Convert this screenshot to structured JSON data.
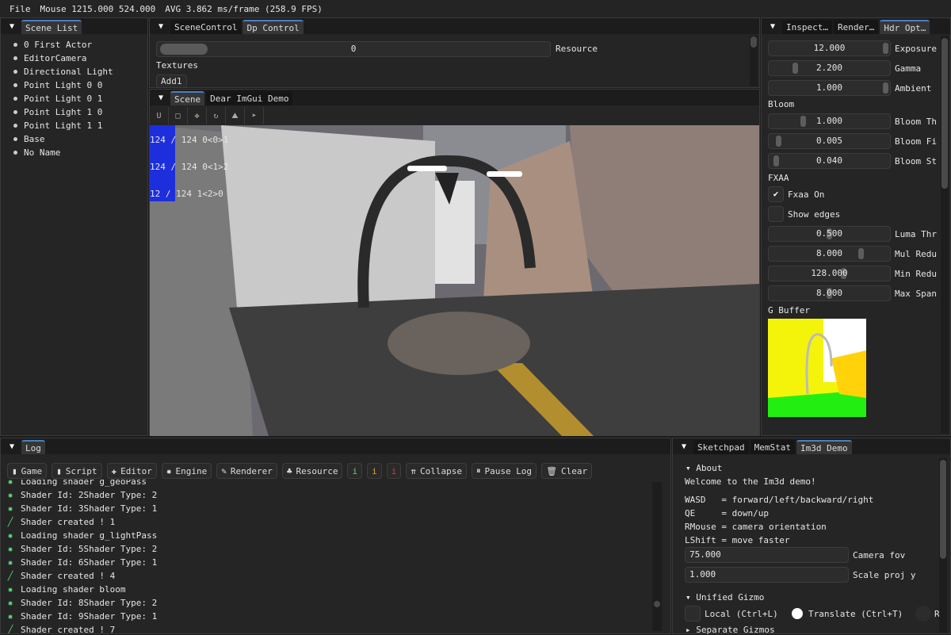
{
  "menu": {
    "file": "File",
    "mouse": "Mouse 1215.000 524.000",
    "avg": "AVG 3.862 ms/frame (258.9 FPS)"
  },
  "scene_list": {
    "tab": "Scene List",
    "items": [
      "0 First Actor",
      "EditorCamera",
      "Directional Light",
      "Point Light 0 0",
      "Point Light 0 1",
      "Point Light 1 0",
      "Point Light 1 1",
      "Base",
      "No Name"
    ]
  },
  "top_center": {
    "tabs": [
      "SceneControl",
      "Dp Control"
    ],
    "resource_value": "0",
    "resource_label": "Resource",
    "textures": "Textures",
    "add_button": "Add1"
  },
  "scene": {
    "tabs": [
      "Scene",
      "Dear ImGui Demo"
    ],
    "toolbar": [
      "magnet-icon",
      "select-icon",
      "move-icon",
      "rotate-icon",
      "scale-icon",
      "cursor-icon"
    ],
    "overlay": [
      "124 / 124 0<0>1",
      "124 / 124 0<1>2",
      "12 / 124 1<2>0"
    ]
  },
  "right": {
    "tabs": [
      "Inspect…",
      "Render…",
      "Hdr Opt…"
    ],
    "hdr": [
      {
        "value": "12.000",
        "label": "Exposure",
        "pos": 1.0
      },
      {
        "value": "2.200",
        "label": "Gamma",
        "pos": 0.2
      },
      {
        "value": "1.000",
        "label": "Ambient",
        "pos": 1.0
      }
    ],
    "bloom_header": "Bloom",
    "bloom": [
      {
        "value": "1.000",
        "label": "Bloom Th",
        "pos": 0.27
      },
      {
        "value": "0.005",
        "label": "Bloom Fi",
        "pos": 0.05
      },
      {
        "value": "0.040",
        "label": "Bloom St",
        "pos": 0.03
      }
    ],
    "fxaa_header": "FXAA",
    "fxaa_on": {
      "label": "Fxaa On",
      "checked": true
    },
    "show_edges": {
      "label": "Show edges",
      "checked": false
    },
    "fxaa": [
      {
        "value": "0.500",
        "label": "Luma Thr",
        "pos": 0.5
      },
      {
        "value": "8.000",
        "label": "Mul Redu",
        "pos": 0.78
      },
      {
        "value": "128.000",
        "label": "Min Redu",
        "pos": 0.63
      },
      {
        "value": "8.000",
        "label": "Max Span",
        "pos": 0.5
      }
    ],
    "gbuffer": "G Buffer"
  },
  "log": {
    "tab": "Log",
    "filters": [
      "Game",
      "Script",
      "Editor",
      "Engine",
      "Renderer",
      "Resource"
    ],
    "levels": [
      "i",
      "i",
      "i"
    ],
    "collapse": "Collapse",
    "pause": "Pause Log",
    "clear": "Clear",
    "lines": [
      {
        "t": "gear",
        "m": "Loading shader g_geoPass"
      },
      {
        "t": "gear",
        "m": "Shader Id: 2Shader Type: 2"
      },
      {
        "t": "gear",
        "m": "Shader Id: 3Shader Type: 1"
      },
      {
        "t": "brush",
        "m": "Shader created ! 1"
      },
      {
        "t": "gear",
        "m": "Loading shader g_lightPass"
      },
      {
        "t": "gear",
        "m": "Shader Id: 5Shader Type: 2"
      },
      {
        "t": "gear",
        "m": "Shader Id: 6Shader Type: 1"
      },
      {
        "t": "brush",
        "m": "Shader created ! 4"
      },
      {
        "t": "gear",
        "m": "Loading shader bloom"
      },
      {
        "t": "gear",
        "m": "Shader Id: 8Shader Type: 2"
      },
      {
        "t": "gear",
        "m": "Shader Id: 9Shader Type: 1"
      },
      {
        "t": "brush",
        "m": "Shader created ! 7"
      }
    ]
  },
  "im3d": {
    "tabs": [
      "Sketchpad",
      "MemStat",
      "Im3d Demo"
    ],
    "about": "About",
    "welcome": "Welcome to the Im3d demo!",
    "keys": [
      "WASD   = forward/left/backward/right",
      "QE     = down/up",
      "RMouse = camera orientation",
      "LShift = move faster"
    ],
    "fov_value": "75.000",
    "fov_label": "Camera fov",
    "scale_value": "1.000",
    "scale_label": "Scale proj y",
    "unified": "Unified Gizmo",
    "local": "Local (Ctrl+L)",
    "translate": "Translate (Ctrl+T)",
    "r": "R",
    "separate": "Separate Gizmos"
  }
}
